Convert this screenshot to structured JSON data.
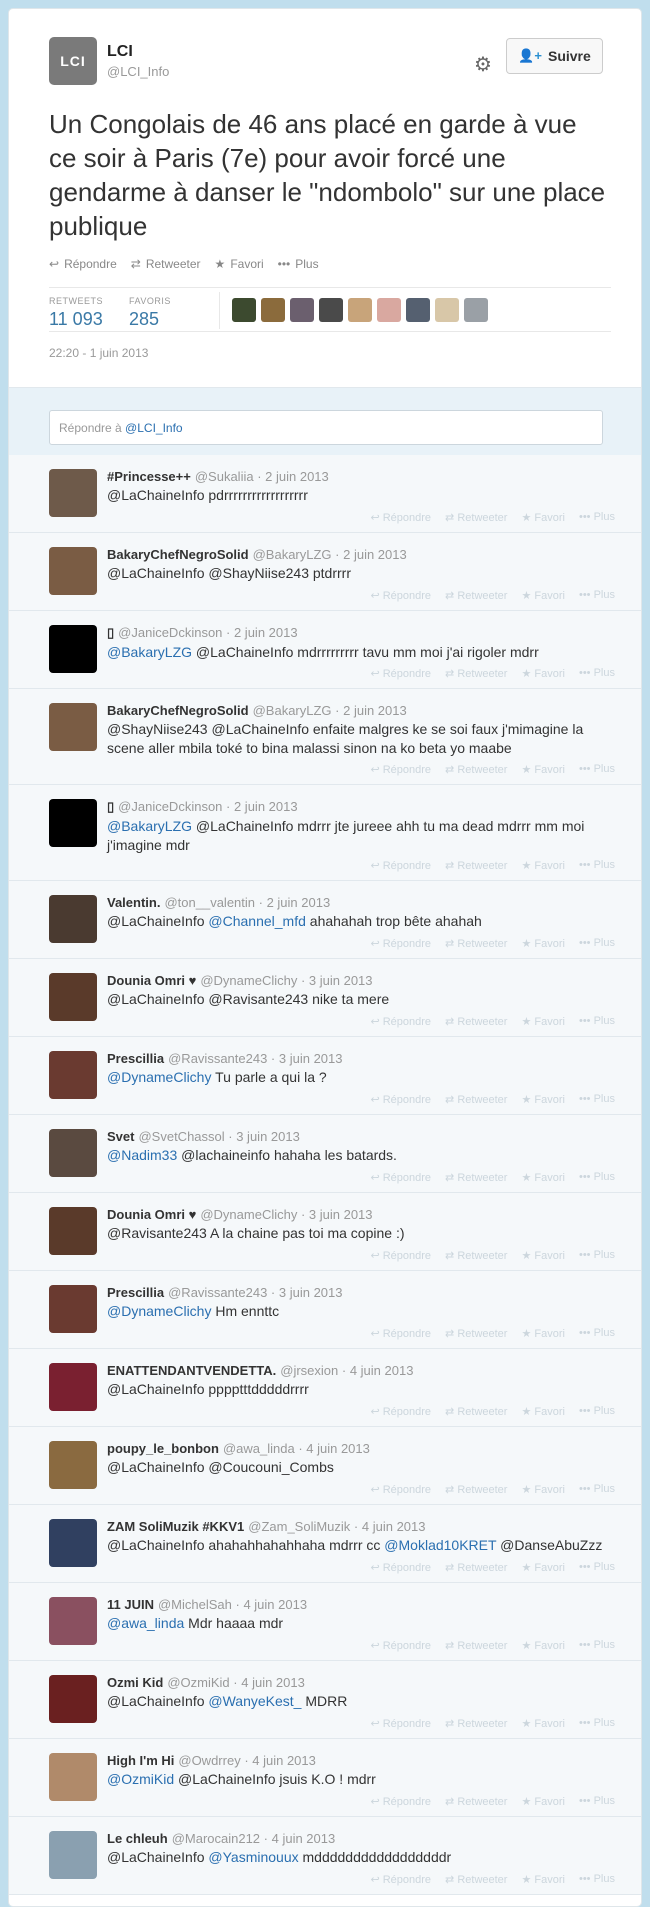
{
  "tweet": {
    "author_name": "LCI",
    "author_handle": "@LCI_Info",
    "logo_text": "LCI",
    "follow_label": "Suivre",
    "text": "Un Congolais de 46 ans placé en garde à vue ce soir à Paris (7e) pour avoir forcé une gendarme à danser le \"ndombolo\" sur une place publique",
    "actions": [
      "Répondre",
      "Retweeter",
      "Favori",
      "Plus"
    ],
    "retweets_label": "RETWEETS",
    "retweets": "11 093",
    "favorites_label": "FAVORIS",
    "favorites": "285",
    "timestamp": "22:20 - 1 juin 2013"
  },
  "reply_box": {
    "prefix": "Répondre à ",
    "handle": "@LCI_Info"
  },
  "reply_actions": [
    "Répondre",
    "Retweeter",
    "Favori",
    "Plus"
  ],
  "colors": {
    "link": "#2a6fb0",
    "stat": "#3a79a6",
    "background": "#c0deed"
  },
  "replies": [
    {
      "name": "#Princesse++",
      "handle": "@Sukaliia",
      "date": "2 juin 2013",
      "text": "@LaChaineInfo pdrrrrrrrrrrrrrrrrrr"
    },
    {
      "name": "BakaryChefNegroSolid",
      "handle": "@BakaryLZG",
      "date": "2 juin 2013",
      "text": "@LaChaineInfo @ShayNiise243 ptdrrrr"
    },
    {
      "name": "",
      "handle": "@JaniceDckinson",
      "date": "2 juin 2013",
      "link": "@BakaryLZG",
      "text": " @LaChaineInfo mdrrrrrrrrr tavu mm moi j'ai rigoler mdrr"
    },
    {
      "name": "BakaryChefNegroSolid",
      "handle": "@BakaryLZG",
      "date": "2 juin 2013",
      "text": "@ShayNiise243 @LaChaineInfo enfaite malgres ke se soi faux j'mimagine la scene aller mbila toké to bina malassi sinon na ko beta yo maabe"
    },
    {
      "name": "",
      "handle": "@JaniceDckinson",
      "date": "2 juin 2013",
      "link": "@BakaryLZG",
      "text": " @LaChaineInfo mdrrr jte jureee ahh tu ma dead mdrrr mm moi j'imagine mdr"
    },
    {
      "name": "Valentin.",
      "handle": "@ton__valentin",
      "date": "2 juin 2013",
      "pre": "@LaChaineInfo ",
      "link": "@Channel_mfd",
      "text": " ahahahah trop bête ahahah"
    },
    {
      "name": "Dounia Omri ♥",
      "handle": "@DynameClichy",
      "date": "3 juin 2013",
      "text": "@LaChaineInfo @Ravisante243 nike ta mere"
    },
    {
      "name": "Prescillia",
      "handle": "@Ravissante243",
      "date": "3 juin 2013",
      "link": "@DynameClichy",
      "text": " Tu parle a qui la ?"
    },
    {
      "name": "Svet",
      "handle": "@SvetChassol",
      "date": "3 juin 2013",
      "link": "@Nadim33",
      "text": " @lachaineinfo hahaha les batards."
    },
    {
      "name": "Dounia Omri ♥",
      "handle": "@DynameClichy",
      "date": "3 juin 2013",
      "text": "@Ravisante243 A la chaine pas toi ma copine :)"
    },
    {
      "name": "Prescillia",
      "handle": "@Ravissante243",
      "date": "3 juin 2013",
      "link": "@DynameClichy",
      "text": " Hm ennttc"
    },
    {
      "name": "ENATTENDANTVENDETTA.",
      "handle": "@jrsexion",
      "date": "4 juin 2013",
      "text": "@LaChaineInfo pppptttdddddrrrr"
    },
    {
      "name": "poupy_le_bonbon",
      "handle": "@awa_linda",
      "date": "4 juin 2013",
      "text": "@LaChaineInfo @Coucouni_Combs"
    },
    {
      "name": "ZAM SoliMuzik #KKV1",
      "handle": "@Zam_SoliMuzik",
      "date": "4 juin 2013",
      "pre": "@LaChaineInfo ahahahhahahhaha mdrrr cc ",
      "link": "@Moklad10KRET",
      "text": " @DanseAbuZzz"
    },
    {
      "name": "11 JUIN",
      "handle": "@MichelSah",
      "date": "4 juin 2013",
      "link": "@awa_linda",
      "text": " Mdr haaaa mdr"
    },
    {
      "name": "Ozmi Kid",
      "handle": "@OzmiKid",
      "date": "4 juin 2013",
      "pre": "@LaChaineInfo ",
      "link": "@WanyeKest_",
      "text": " MDRR"
    },
    {
      "name": "High I'm Hi",
      "handle": "@Owdrrey",
      "date": "4 juin 2013",
      "link": "@OzmiKid",
      "text": " @LaChaineInfo jsuis K.O ! mdrr"
    },
    {
      "name": "Le chleuh",
      "handle": "@Marocain212",
      "date": "4 juin 2013",
      "pre": "@LaChaineInfo ",
      "link": "@Yasminouux",
      "text": " mdddddddddddddddddr"
    }
  ]
}
